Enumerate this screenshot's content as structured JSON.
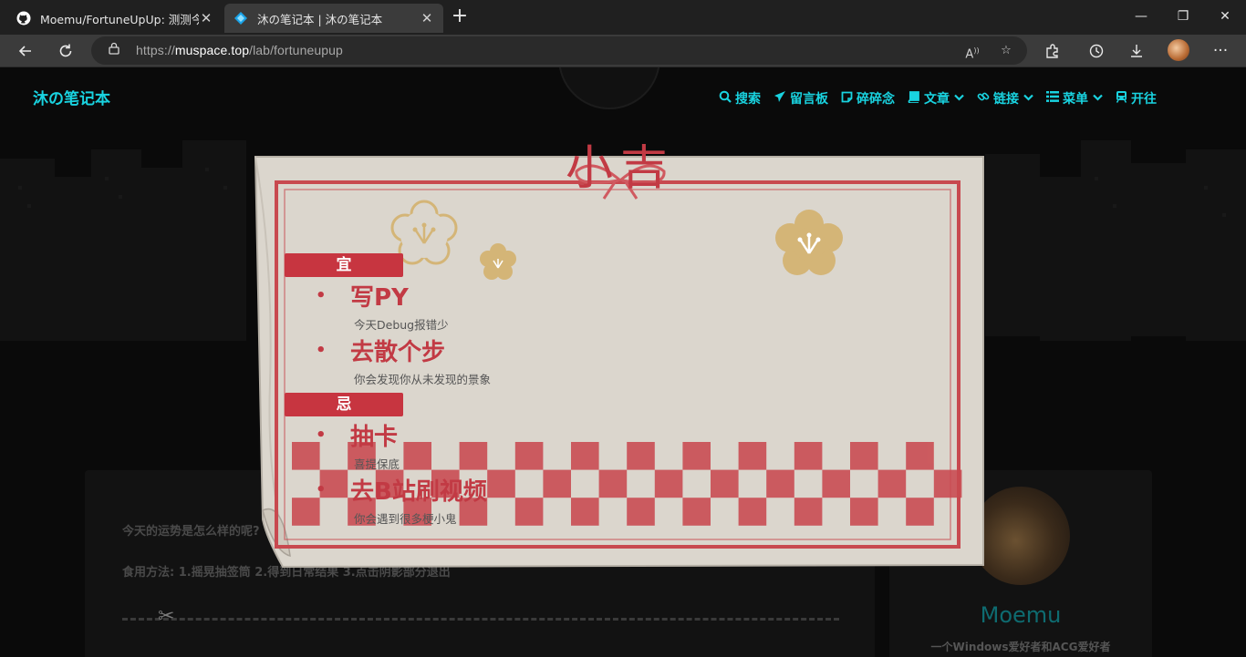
{
  "browser": {
    "tabs": [
      {
        "label": "Moemu/FortuneUpUp: 测测今天",
        "active": false
      },
      {
        "label": "沐の笔记本 | 沐の笔记本",
        "active": true
      }
    ],
    "address": {
      "scheme": "https://",
      "host": "muspace.top",
      "path": "/lab/fortuneupup"
    },
    "window_controls": {
      "minimize": "—",
      "restore": "❐",
      "close": "✕"
    }
  },
  "site": {
    "title": "沐の笔记本",
    "nav": [
      {
        "icon": "search-icon",
        "label": "搜索",
        "has_dropdown": false
      },
      {
        "icon": "paper-plane-icon",
        "label": "留言板",
        "has_dropdown": false
      },
      {
        "icon": "note-icon",
        "label": "碎碎念",
        "has_dropdown": false
      },
      {
        "icon": "book-icon",
        "label": "文章",
        "has_dropdown": true
      },
      {
        "icon": "link-icon",
        "label": "链接",
        "has_dropdown": true
      },
      {
        "icon": "list-icon",
        "label": "菜单",
        "has_dropdown": true
      },
      {
        "icon": "train-icon",
        "label": "开往",
        "has_dropdown": false
      }
    ]
  },
  "article": {
    "intro": "今天的运势是怎么样的呢?",
    "usage": "食用方法: 1.摇晃抽签筒 2.得到日常结果 3.点击阴影部分退出"
  },
  "profile": {
    "name": "Moemu",
    "bio": "一个Windows爱好者和ACG爱好者"
  },
  "fortune": {
    "result": "小吉",
    "good_label": "宜",
    "good": [
      {
        "title": "写PY",
        "desc": "今天Debug报错少"
      },
      {
        "title": "去散个步",
        "desc": "你会发现你从未发现的景象"
      }
    ],
    "bad_label": "忌",
    "bad": [
      {
        "title": "抽卡",
        "desc": "喜提保底"
      },
      {
        "title": "去B站刷视频",
        "desc": "你会遇到很多梗小鬼"
      }
    ]
  },
  "colors": {
    "accent": "#19d3e0",
    "fortune_red": "#c23a44",
    "card_paper": "#ddd8d0",
    "flower_gold": "#cfa861"
  }
}
